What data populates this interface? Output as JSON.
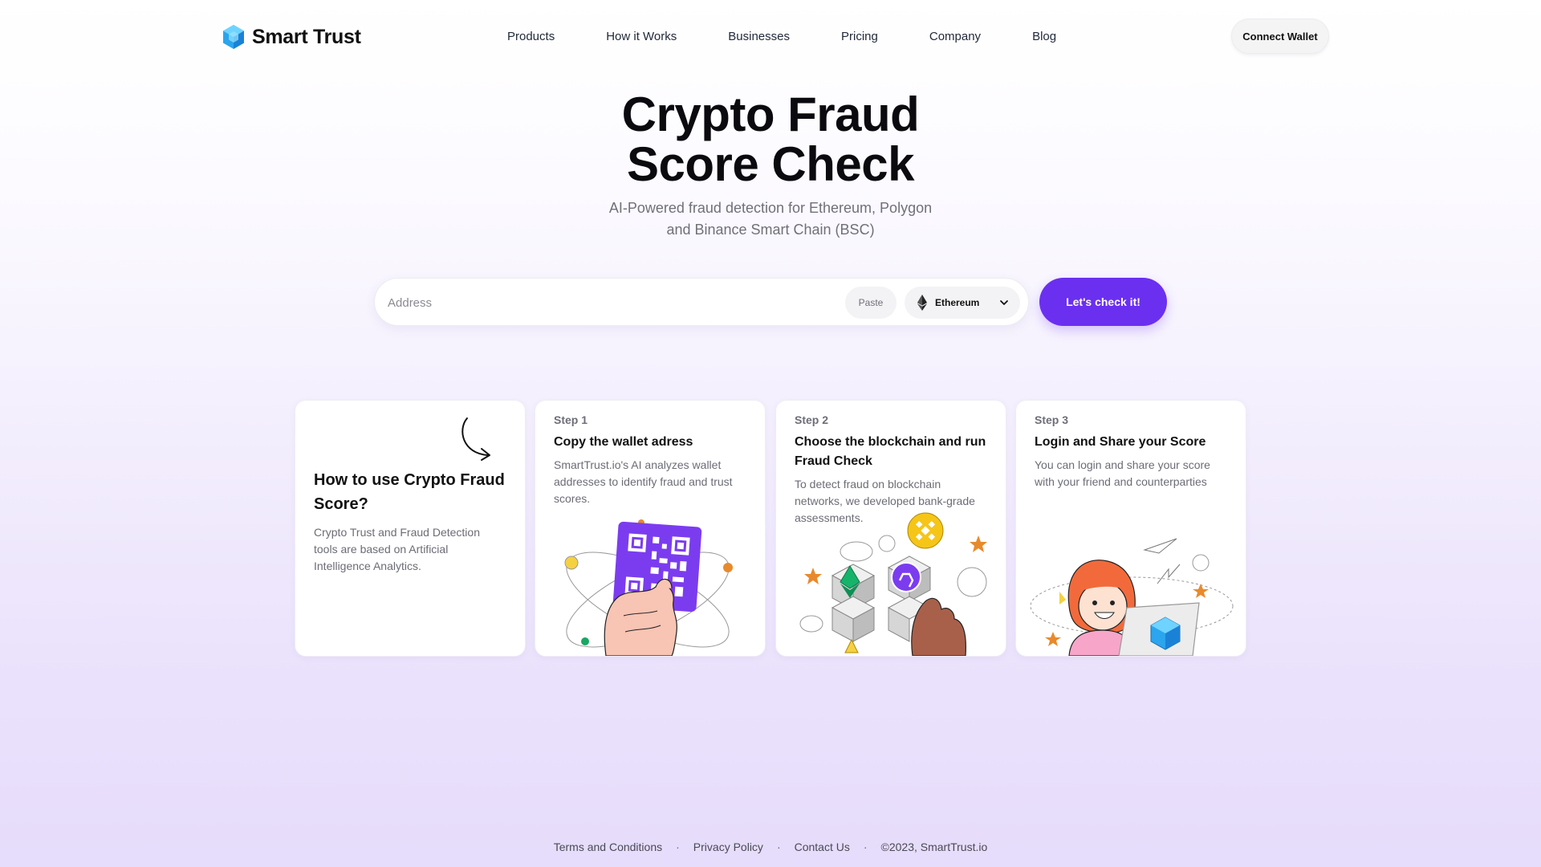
{
  "header": {
    "logo_text": "Smart Trust",
    "nav": [
      "Products",
      "How it Works",
      "Businesses",
      "Pricing",
      "Company",
      "Blog"
    ],
    "connect_label": "Connect Wallet"
  },
  "hero": {
    "title_line1": "Crypto Fraud",
    "title_line2": "Score Check",
    "subtitle_line1": "AI-Powered fraud detection for Ethereum, Polygon",
    "subtitle_line2": "and Binance Smart Chain (BSC)"
  },
  "search": {
    "placeholder": "Address",
    "paste_label": "Paste",
    "chain_selected": "Ethereum",
    "submit_label": "Let's check it!"
  },
  "intro_card": {
    "title": "How to use Crypto Fraud Score?",
    "text": "Crypto Trust and Fraud Detection tools are based on Artificial Intelligence Analytics."
  },
  "steps": [
    {
      "label": "Step 1",
      "title": "Copy the wallet adress",
      "text": "SmartTrust.io's AI analyzes wallet addresses to identify fraud and trust scores."
    },
    {
      "label": "Step 2",
      "title": "Choose the blockchain and run Fraud Check",
      "text": "To detect fraud on blockchain networks, we developed bank-grade assessments."
    },
    {
      "label": "Step 3",
      "title": "Login and Share your Score",
      "text": "You can login and share your score with your friend and counterparties"
    }
  ],
  "footer": {
    "terms": "Terms and Conditions",
    "privacy": "Privacy Policy",
    "contact": "Contact Us",
    "copyright": "©2023, SmartTrust.io"
  },
  "colors": {
    "accent": "#6b2ff0",
    "logo_blue": "#2aa5ee"
  }
}
